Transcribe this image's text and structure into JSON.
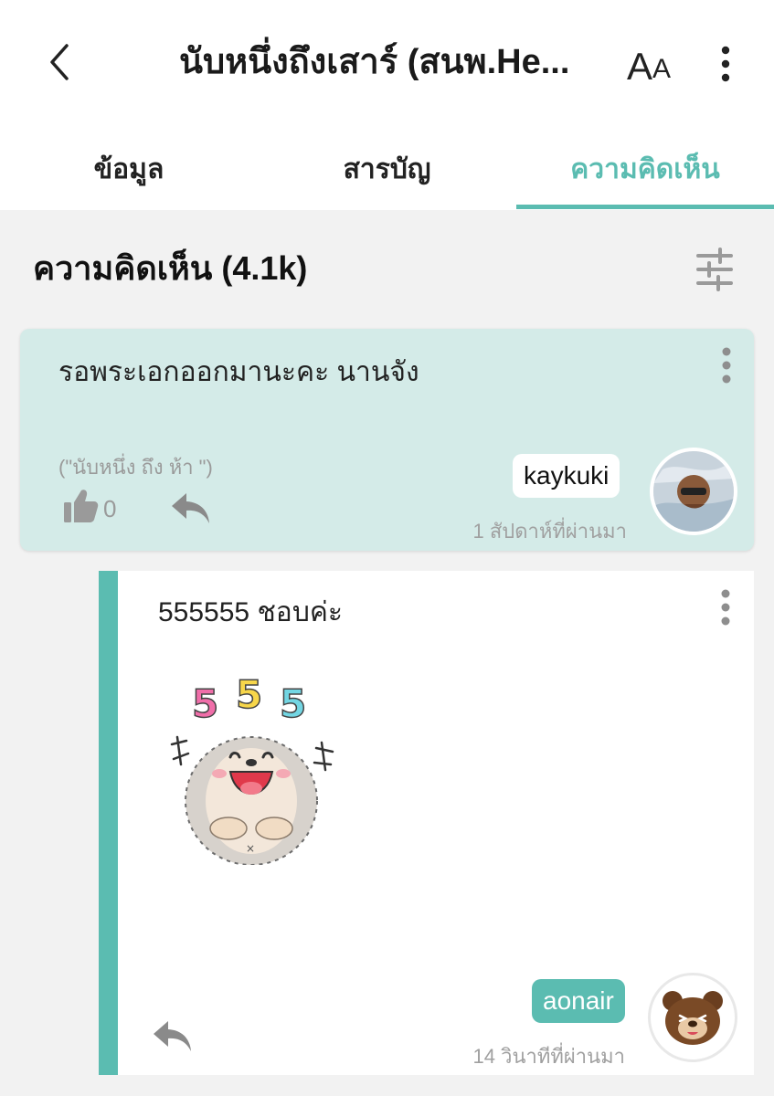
{
  "header": {
    "title": "นับหนึ่งถึงเสาร์ (สนพ.He...",
    "font_size_big": "A",
    "font_size_small": "A"
  },
  "tabs": [
    {
      "label": "ข้อมูล",
      "active": false
    },
    {
      "label": "สารบัญ",
      "active": false
    },
    {
      "label": "ความคิดเห็น",
      "active": true
    }
  ],
  "section": {
    "title": "ความคิดเห็น (4.1k)"
  },
  "comment": {
    "text": "รอพระเอกออกมานะคะ นานจัง",
    "quote": "(\"นับหนึ่ง ถึง ห้า \")",
    "likes": "0",
    "username": "kaykuki",
    "time": "1 สัปดาห์ที่ผ่านมา"
  },
  "reply": {
    "text": "555555 ชอบค่ะ",
    "sticker_text": [
      "5",
      "5",
      "5"
    ],
    "username": "aonair",
    "time": "14 วินาทีที่ผ่านมา"
  },
  "colors": {
    "accent": "#5bbcb1",
    "comment_bg": "#d4ebe8",
    "page_bg": "#f2f2f2"
  },
  "icons": {
    "back": "chevron-left-icon",
    "more": "more-vertical-icon",
    "filter": "sliders-icon",
    "like": "thumbs-up-icon",
    "reply": "reply-icon"
  }
}
